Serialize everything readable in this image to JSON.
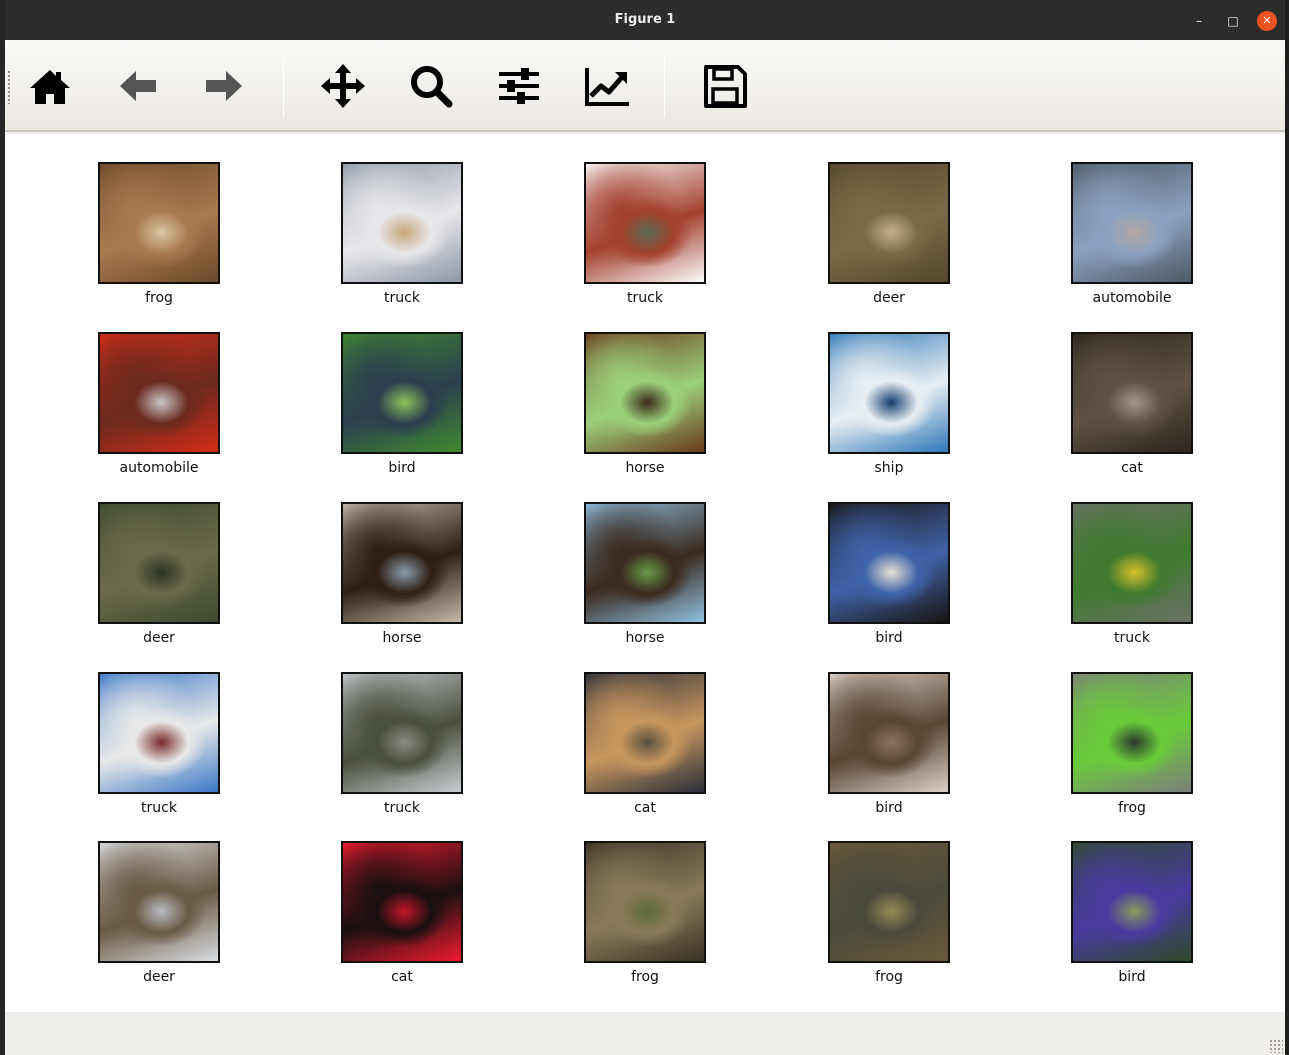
{
  "window": {
    "title": "Figure 1",
    "controls": {
      "minimize": "–",
      "maximize": "□",
      "close": "✕"
    },
    "close_color": "#e95420"
  },
  "toolbar": {
    "tools": [
      {
        "name": "home",
        "icon": "home-icon"
      },
      {
        "name": "back",
        "icon": "arrow-left-icon"
      },
      {
        "name": "forward",
        "icon": "arrow-right-icon"
      },
      {
        "name": "pan",
        "icon": "move-icon"
      },
      {
        "name": "zoom",
        "icon": "magnifier-icon"
      },
      {
        "name": "configure-subplots",
        "icon": "sliders-icon"
      },
      {
        "name": "edit-axes",
        "icon": "line-chart-icon"
      },
      {
        "name": "save",
        "icon": "floppy-disk-icon"
      }
    ]
  },
  "figure": {
    "rows": 5,
    "cols": 5,
    "images": [
      {
        "label": "frog",
        "colors": [
          "#6b4a2a",
          "#a87a4e",
          "#d9c7a3"
        ]
      },
      {
        "label": "truck",
        "colors": [
          "#8f98a6",
          "#e7e7ea",
          "#c7a77a"
        ]
      },
      {
        "label": "truck",
        "colors": [
          "#fbfbfb",
          "#a4412f",
          "#5c6a52"
        ]
      },
      {
        "label": "deer",
        "colors": [
          "#56482c",
          "#7b6a47",
          "#c6b08c"
        ]
      },
      {
        "label": "automobile",
        "colors": [
          "#4d5a66",
          "#8ba1c0",
          "#b3a8a3"
        ]
      },
      {
        "label": "automobile",
        "colors": [
          "#d22c18",
          "#6b2a1e",
          "#c7c7c7"
        ]
      },
      {
        "label": "bird",
        "colors": [
          "#3f8a2f",
          "#2b3f4f",
          "#8cc25a"
        ]
      },
      {
        "label": "horse",
        "colors": [
          "#6a3a1c",
          "#9bd07a",
          "#3b2a1b"
        ]
      },
      {
        "label": "ship",
        "colors": [
          "#2f78b8",
          "#e8eef2",
          "#143f70"
        ]
      },
      {
        "label": "cat",
        "colors": [
          "#2c261f",
          "#5e5245",
          "#a09787"
        ]
      },
      {
        "label": "deer",
        "colors": [
          "#3d4a2e",
          "#6b6a4a",
          "#2a3321"
        ]
      },
      {
        "label": "horse",
        "colors": [
          "#c3b8a9",
          "#2d1f16",
          "#8c9ca9"
        ]
      },
      {
        "label": "horse",
        "colors": [
          "#8fbfe0",
          "#3a2a1f",
          "#6a9a4a"
        ]
      },
      {
        "label": "bird",
        "colors": [
          "#1a1412",
          "#3f63a8",
          "#e8e2d6"
        ]
      },
      {
        "label": "truck",
        "colors": [
          "#6b6f66",
          "#3f7a2f",
          "#d6c02a"
        ]
      },
      {
        "label": "truck",
        "colors": [
          "#3b78c8",
          "#e8e8e8",
          "#7a2a2a"
        ]
      },
      {
        "label": "truck",
        "colors": [
          "#c7cbd0",
          "#4a4f3f",
          "#8a8a82"
        ]
      },
      {
        "label": "cat",
        "colors": [
          "#2a2f3a",
          "#c8965e",
          "#58503f"
        ]
      },
      {
        "label": "bird",
        "colors": [
          "#d9cfc8",
          "#5a4532",
          "#8a7460"
        ]
      },
      {
        "label": "frog",
        "colors": [
          "#7c7f7a",
          "#6acb3a",
          "#2b3a2e"
        ]
      },
      {
        "label": "deer",
        "colors": [
          "#d9dde3",
          "#6b5a44",
          "#b8bcc4"
        ]
      },
      {
        "label": "cat",
        "colors": [
          "#f01b2e",
          "#1a1012",
          "#c4162a"
        ]
      },
      {
        "label": "frog",
        "colors": [
          "#3a3424",
          "#8a7a5a",
          "#5a6a3a"
        ]
      },
      {
        "label": "frog",
        "colors": [
          "#6a5a3a",
          "#4a4a3a",
          "#9a8a5a"
        ]
      },
      {
        "label": "bird",
        "colors": [
          "#2f4a2a",
          "#4a3aa0",
          "#8a9a5a"
        ]
      }
    ]
  }
}
